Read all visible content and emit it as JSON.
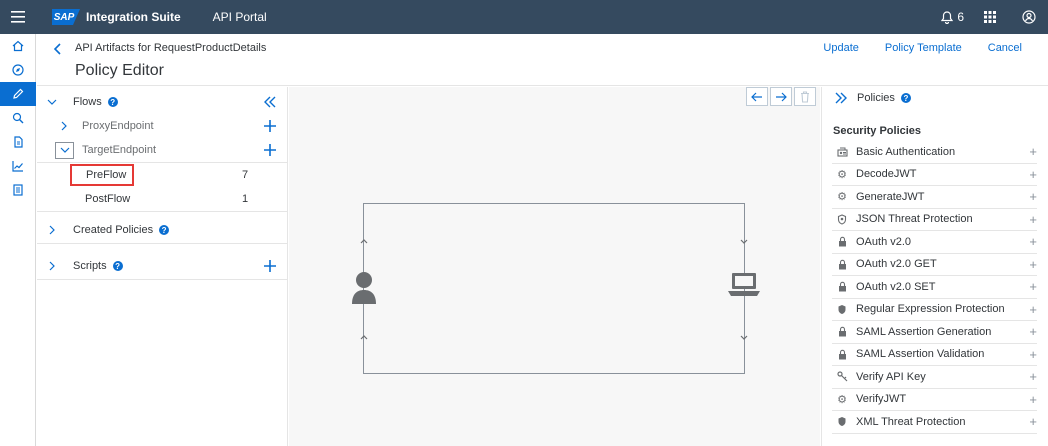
{
  "shell": {
    "logo_text": "SAP",
    "product": "Integration Suite",
    "area": "API Portal",
    "notification_count": "6"
  },
  "header": {
    "breadcrumb": "API Artifacts for RequestProductDetails",
    "title": "Policy Editor",
    "actions": {
      "update": "Update",
      "policy_template": "Policy Template",
      "cancel": "Cancel"
    }
  },
  "flows": {
    "title": "Flows",
    "proxy_endpoint": "ProxyEndpoint",
    "target_endpoint": "TargetEndpoint",
    "preflow": {
      "label": "PreFlow",
      "count": "7"
    },
    "postflow": {
      "label": "PostFlow",
      "count": "1"
    },
    "created_policies": "Created Policies",
    "scripts": "Scripts",
    "help_glyph": "?"
  },
  "policies": {
    "title": "Policies",
    "section": "Security Policies",
    "items": [
      {
        "label": "Basic Authentication",
        "icon": "id-card-icon"
      },
      {
        "label": "DecodeJWT",
        "icon": "gear-icon"
      },
      {
        "label": "GenerateJWT",
        "icon": "gear-icon"
      },
      {
        "label": "JSON Threat Protection",
        "icon": "shield-icon"
      },
      {
        "label": "OAuth v2.0",
        "icon": "lock-icon"
      },
      {
        "label": "OAuth v2.0 GET",
        "icon": "lock-icon"
      },
      {
        "label": "OAuth v2.0 SET",
        "icon": "lock-icon"
      },
      {
        "label": "Regular Expression Protection",
        "icon": "shield-icon"
      },
      {
        "label": "SAML Assertion Generation",
        "icon": "lock-icon"
      },
      {
        "label": "SAML Assertion Validation",
        "icon": "lock-icon"
      },
      {
        "label": "Verify API Key",
        "icon": "key-icon"
      },
      {
        "label": "VerifyJWT",
        "icon": "gear-icon"
      },
      {
        "label": "XML Threat Protection",
        "icon": "shield-icon"
      }
    ]
  },
  "colors": {
    "shell": "#354a5f",
    "accent": "#0a6ed1",
    "highlight": "#e53935"
  }
}
